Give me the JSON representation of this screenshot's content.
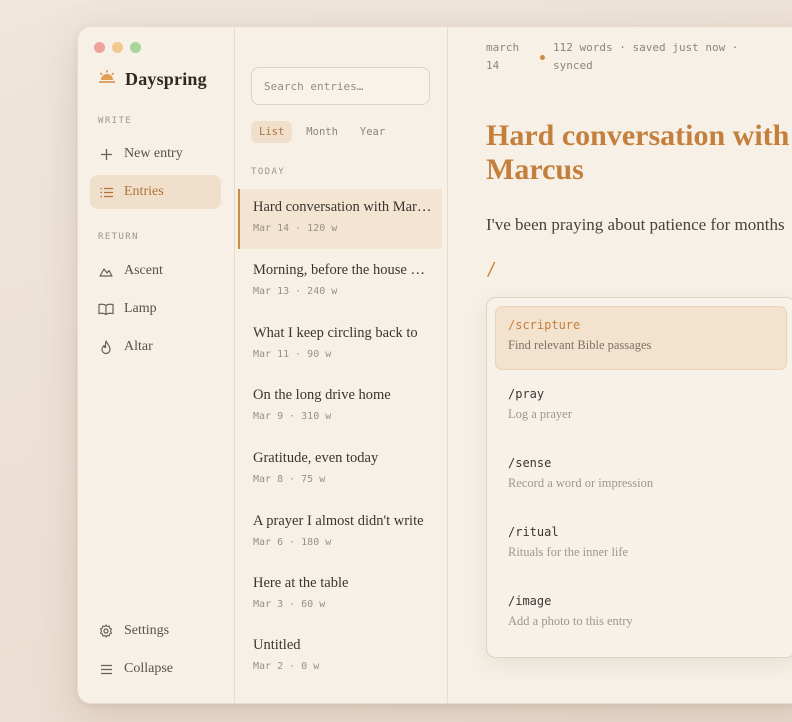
{
  "colors": {
    "accent": "#cf8a44",
    "title": "#c47f3d",
    "close": "#eea39a",
    "minimize": "#f0c98e",
    "zoom": "#a9d49a"
  },
  "sidebar": {
    "brand": "Dayspring",
    "write_label": "WRITE",
    "write_items": [
      {
        "label": "New entry",
        "icon": "plus-icon"
      },
      {
        "label": "Entries",
        "icon": "list-icon",
        "active": true
      }
    ],
    "return_label": "RETURN",
    "return_items": [
      {
        "label": "Ascent",
        "icon": "mountain-icon"
      },
      {
        "label": "Lamp",
        "icon": "book-icon"
      },
      {
        "label": "Altar",
        "icon": "flame-icon"
      }
    ],
    "settings": "Settings",
    "collapse": "Collapse"
  },
  "list": {
    "search_placeholder": "Search entries…",
    "views": [
      "List",
      "Month",
      "Year"
    ],
    "group": "TODAY",
    "entries": [
      {
        "title": "Hard conversation with Marcus",
        "meta": "Mar 14 · 120 w"
      },
      {
        "title": "Morning, before the house wakes",
        "meta": "Mar 13 · 240 w"
      },
      {
        "title": "What I keep circling back to",
        "meta": "Mar 11 · 90 w"
      },
      {
        "title": "On the long drive home",
        "meta": "Mar 9 · 310 w"
      },
      {
        "title": "Gratitude, even today",
        "meta": "Mar 8 · 75 w"
      },
      {
        "title": "A prayer I almost didn't write",
        "meta": "Mar 6 · 180 w"
      },
      {
        "title": "Here at the table",
        "meta": "Mar 3 · 60 w"
      },
      {
        "title": "Untitled",
        "meta": "Mar 2 · 0 w"
      }
    ]
  },
  "editor": {
    "date_line1": "march",
    "date_line2": "14",
    "status": "112 words · saved just now · synced",
    "title_line1": "Hard conversation with",
    "title_line2": "Marcus",
    "body": "I've been praying about patience for months",
    "slash": "/",
    "commands": [
      {
        "name": "/scripture",
        "desc": "Find relevant Bible passages"
      },
      {
        "name": "/pray",
        "desc": "Log a prayer"
      },
      {
        "name": "/sense",
        "desc": "Record a word or impression"
      },
      {
        "name": "/ritual",
        "desc": "Rituals for the inner life"
      },
      {
        "name": "/image",
        "desc": "Add a photo to this entry"
      }
    ]
  }
}
